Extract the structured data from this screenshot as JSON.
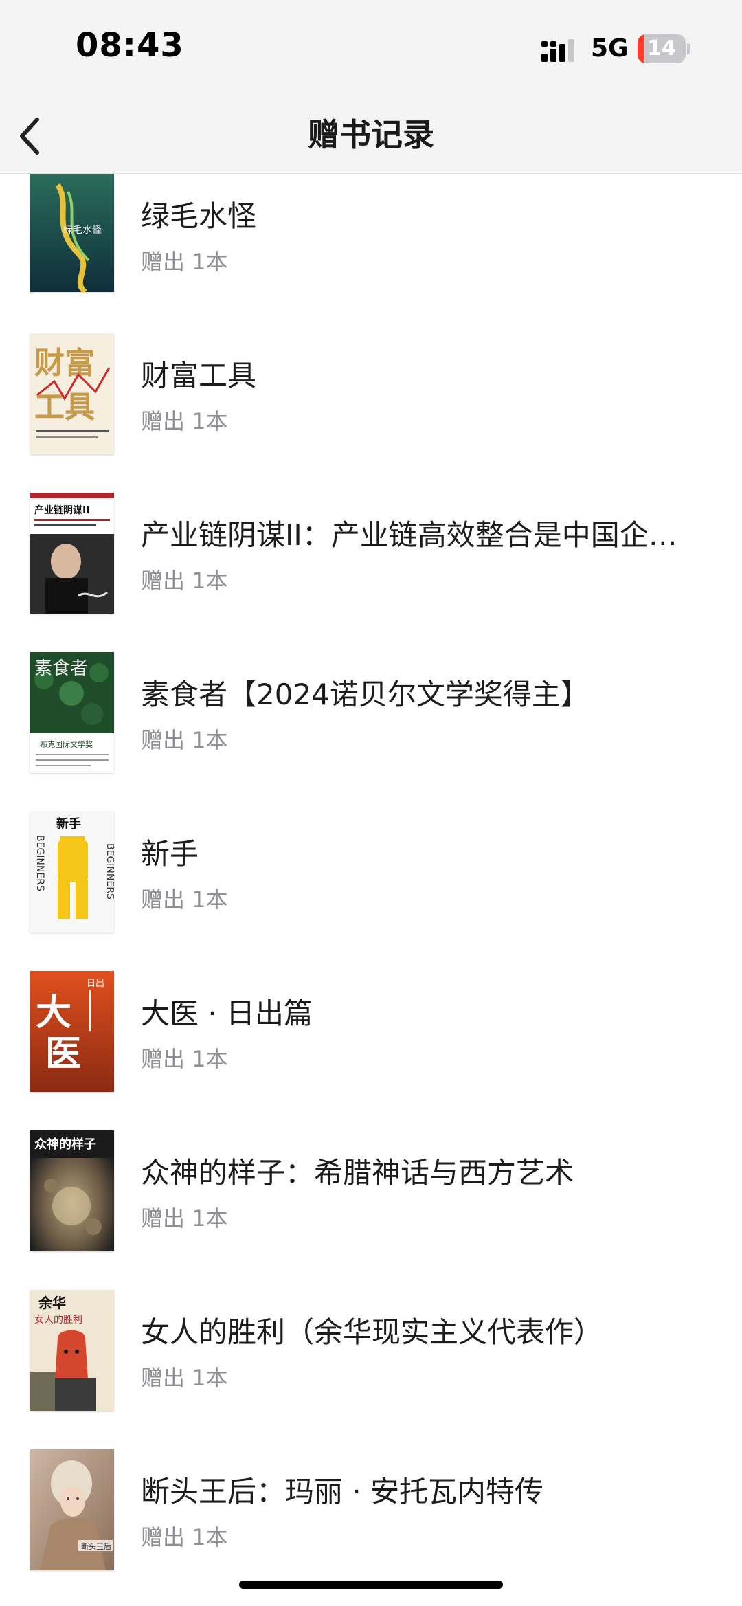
{
  "status_bar": {
    "time": "08:43",
    "network": "5G",
    "battery_level": "14"
  },
  "nav": {
    "title": "赠书记录",
    "back_icon": "chevron-left-icon"
  },
  "books": [
    {
      "title": "绿毛水怪",
      "count": "赠出 1本",
      "cover_text": "绿毛水怪",
      "cover_color": "#1f5c4c"
    },
    {
      "title": "财富工具",
      "count": "赠出 1本",
      "cover_text": "财富工具",
      "cover_color": "#f6efe0"
    },
    {
      "title": "产业链阴谋II：产业链高效整合是中国企业制胜之道",
      "count": "赠出 1本",
      "cover_text": "产业链阴谋II",
      "cover_color": "#ffffff"
    },
    {
      "title": "素食者【2024诺贝尔文学奖得主】",
      "count": "赠出 1本",
      "cover_text": "素食者",
      "cover_color": "#1f4d2a"
    },
    {
      "title": "新手",
      "count": "赠出 1本",
      "cover_text": "新手",
      "cover_color": "#f8f8f8"
    },
    {
      "title": "大医 · 日出篇",
      "count": "赠出 1本",
      "cover_text": "大医",
      "cover_color": "#c8481d"
    },
    {
      "title": "众神的样子：希腊神话与西方艺术",
      "count": "赠出 1本",
      "cover_text": "众神的样子",
      "cover_color": "#2a2a2a"
    },
    {
      "title": "女人的胜利（余华现实主义代表作）",
      "count": "赠出 1本",
      "cover_text": "余华 女人的胜利",
      "cover_color": "#efe6d3"
    },
    {
      "title": "断头王后：玛丽 · 安托瓦内特传",
      "count": "赠出 1本",
      "cover_text": "断头王后",
      "cover_color": "#b89b86"
    }
  ]
}
